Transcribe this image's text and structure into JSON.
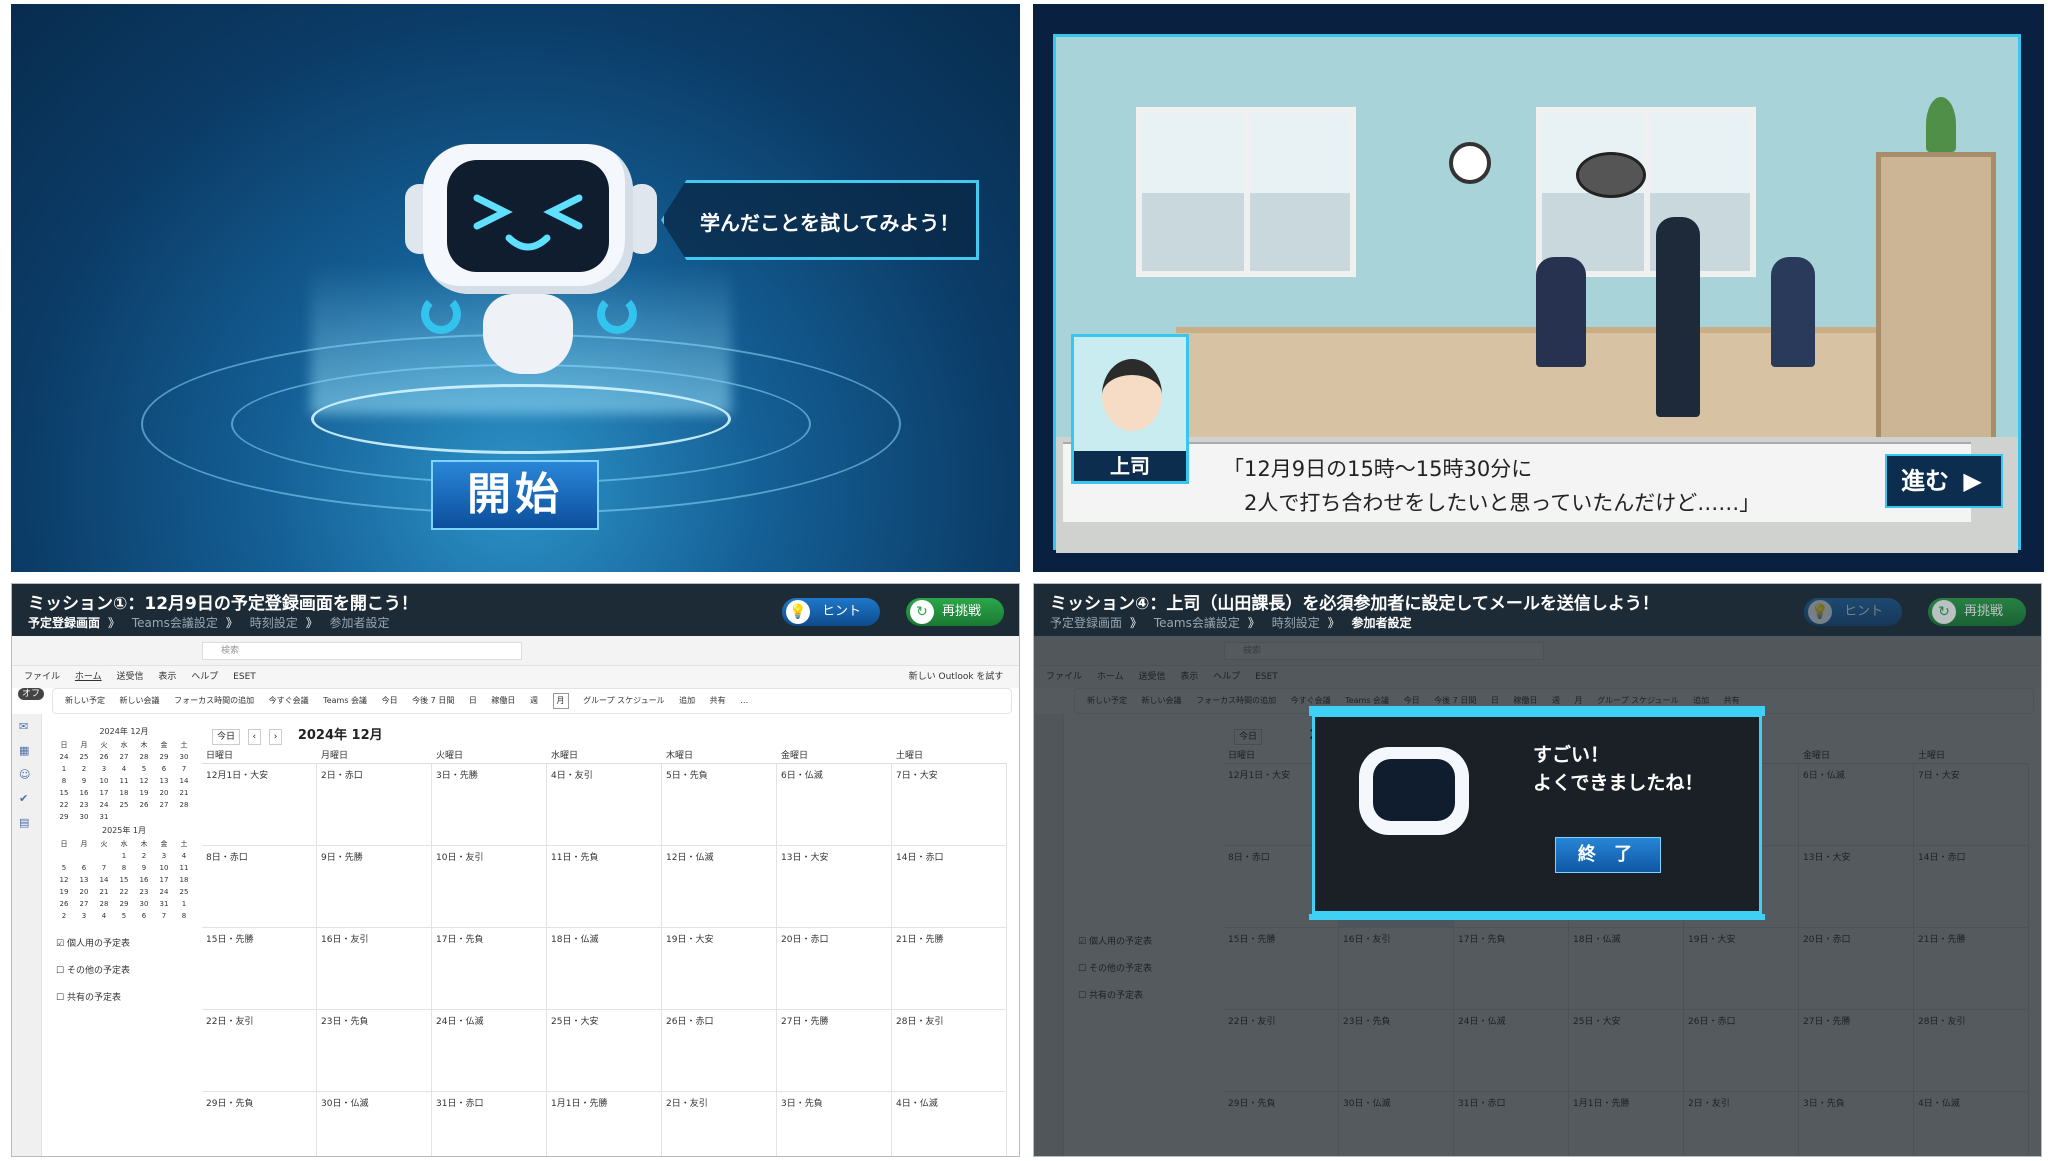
{
  "start_screen": {
    "speech": "学んだことを試してみよう！",
    "start_button": "開始"
  },
  "office_scene": {
    "speaker_label": "上司",
    "line1": "「12月9日の15時～15時30分に",
    "line2": "　2人で打ち合わせをしたいと思っていたんだけど……」",
    "next_button": "進む"
  },
  "mission1": {
    "title": "ミッション①：12月9日の予定登録画面を開こう！",
    "crumbs": [
      "予定登録画面",
      "Teams会議設定",
      "時刻設定",
      "参加者設定"
    ],
    "hint": "ヒント",
    "retry": "再挑戦"
  },
  "mission4": {
    "title": "ミッション④：上司（山田課長）を必須参加者に設定してメールを送信しよう！",
    "crumbs": [
      "予定登録画面",
      "Teams会議設定",
      "時刻設定",
      "参加者設定"
    ],
    "hint": "ヒント",
    "retry": "再挑戦",
    "done_line1": "すごい！",
    "done_line2": "よくできましたね！",
    "end_button": "終 了"
  },
  "outlook": {
    "search_placeholder": "検索",
    "try_new": "新しい Outlook を試す",
    "toggle": "オフ",
    "menu": [
      "ファイル",
      "ホーム",
      "送受信",
      "表示",
      "ヘルプ",
      "ESET"
    ],
    "toolbar": [
      "新しい予定",
      "新しい会議",
      "フォーカス時間の追加",
      "今すぐ会議",
      "Teams 会議",
      "今日",
      "今後 7 日間",
      "日",
      "稼働日",
      "週",
      "月",
      "グループ スケジュール",
      "追加",
      "共有",
      "…"
    ],
    "month_label": "2024年 12月",
    "view_label": "月",
    "today_btn": "今日",
    "weekdays": [
      "日曜日",
      "月曜日",
      "火曜日",
      "水曜日",
      "木曜日",
      "金曜日",
      "土曜日"
    ],
    "weeks": [
      [
        "12月1日・大安",
        "2日・赤口",
        "3日・先勝",
        "4日・友引",
        "5日・先負",
        "6日・仏滅",
        "7日・大安"
      ],
      [
        "8日・赤口",
        "9日・先勝",
        "10日・友引",
        "11日・先負",
        "12日・仏滅",
        "13日・大安",
        "14日・赤口"
      ],
      [
        "15日・先勝",
        "16日・友引",
        "17日・先負",
        "18日・仏滅",
        "19日・大安",
        "20日・赤口",
        "21日・先勝"
      ],
      [
        "22日・友引",
        "23日・先負",
        "24日・仏滅",
        "25日・大安",
        "26日・赤口",
        "27日・先勝",
        "28日・友引"
      ],
      [
        "29日・先負",
        "30日・仏滅",
        "31日・赤口",
        "1月1日・先勝",
        "2日・友引",
        "3日・先負",
        "4日・仏滅"
      ]
    ],
    "mini_dow": [
      "日",
      "月",
      "火",
      "水",
      "木",
      "金",
      "土"
    ],
    "mini_dec_title": "2024年 12月",
    "mini_dec": [
      "24",
      "25",
      "26",
      "27",
      "28",
      "29",
      "30",
      "1",
      "2",
      "3",
      "4",
      "5",
      "6",
      "7",
      "8",
      "9",
      "10",
      "11",
      "12",
      "13",
      "14",
      "15",
      "16",
      "17",
      "18",
      "19",
      "20",
      "21",
      "22",
      "23",
      "24",
      "25",
      "26",
      "27",
      "28",
      "29",
      "30",
      "31"
    ],
    "mini_jan_title": "2025年 1月",
    "mini_jan": [
      "",
      "",
      "",
      "1",
      "2",
      "3",
      "4",
      "5",
      "6",
      "7",
      "8",
      "9",
      "10",
      "11",
      "12",
      "13",
      "14",
      "15",
      "16",
      "17",
      "18",
      "19",
      "20",
      "21",
      "22",
      "23",
      "24",
      "25",
      "26",
      "27",
      "28",
      "29",
      "30",
      "31",
      "1",
      "2",
      "3",
      "4",
      "5",
      "6",
      "7",
      "8"
    ],
    "side_items": [
      "個人用の予定表",
      "その他の予定表",
      "共有の予定表"
    ]
  }
}
